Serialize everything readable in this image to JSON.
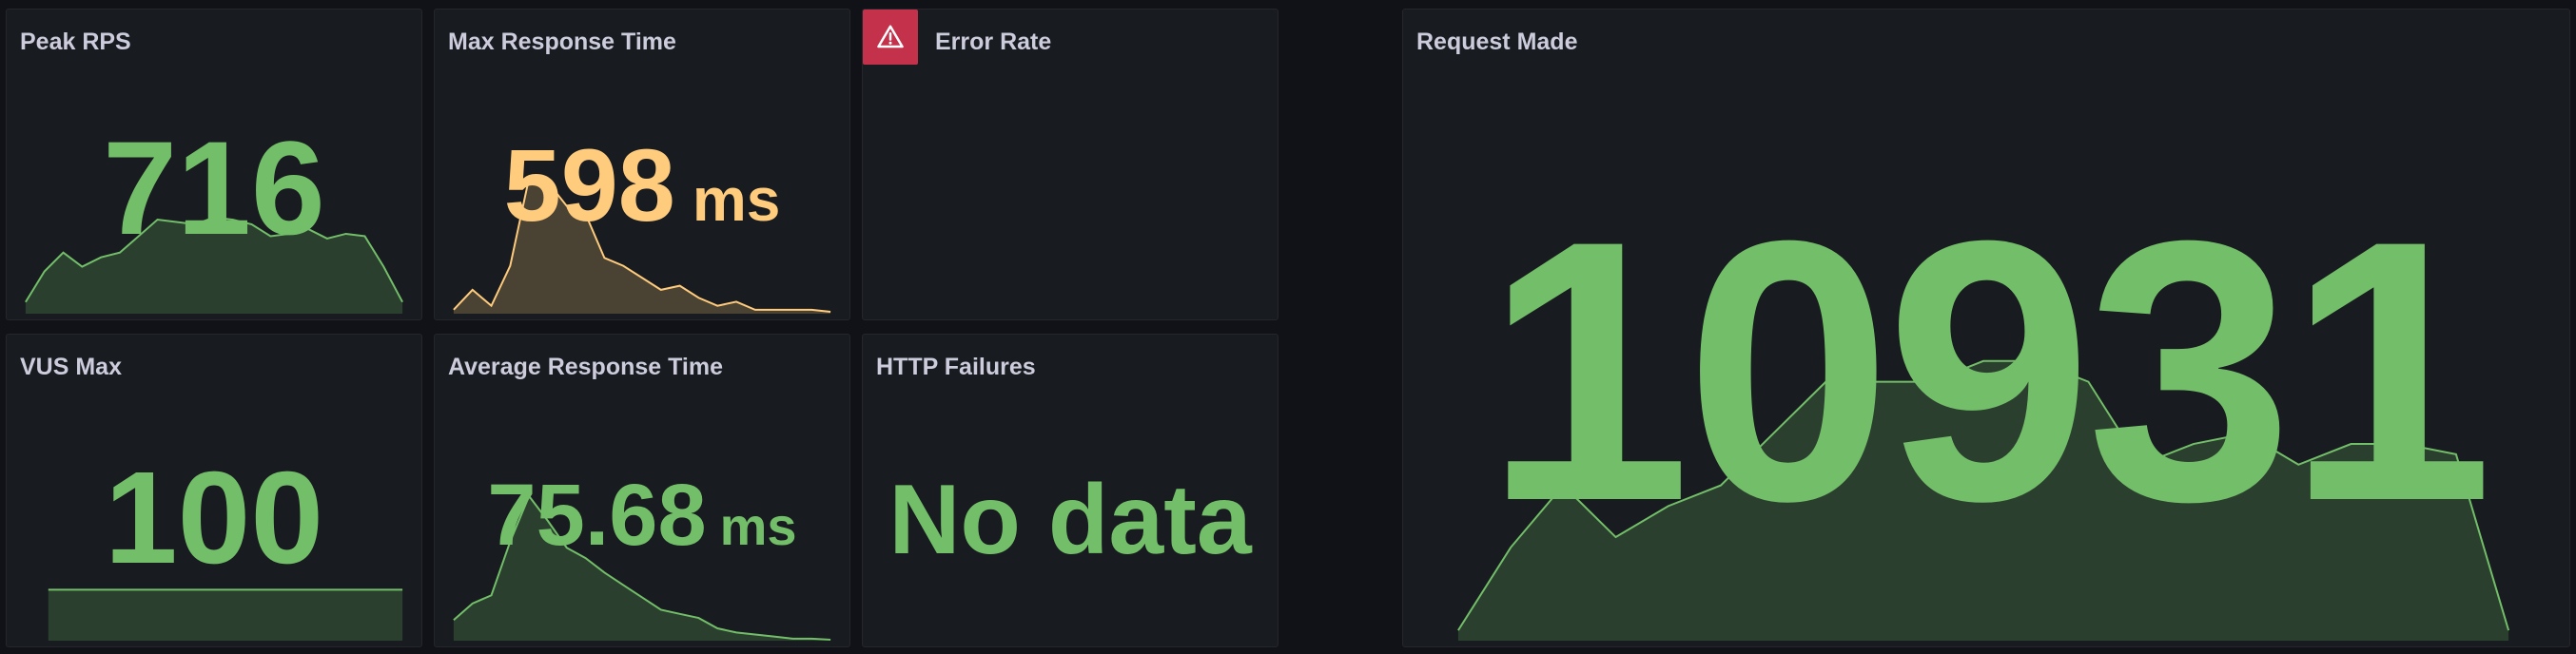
{
  "colors": {
    "green": "#73bf69",
    "orange": "#ffcb7d",
    "error": "#c4314b"
  },
  "panels": {
    "peak_rps": {
      "title": "Peak RPS",
      "value": "716",
      "color": "#73bf69",
      "sparkline": [
        5,
        18,
        26,
        20,
        24,
        26,
        33,
        40,
        39,
        38,
        41,
        40,
        38,
        33,
        34,
        36,
        32,
        34,
        33,
        20,
        5
      ]
    },
    "max_response": {
      "title": "Max Response Time",
      "value": "598",
      "unit": "ms",
      "color": "#ffcb7d",
      "sparkline": [
        1,
        6,
        2,
        12,
        34,
        33,
        27,
        25,
        14,
        12,
        9,
        6,
        7,
        4,
        2,
        3,
        1,
        1,
        1,
        1,
        0.5
      ]
    },
    "error_rate": {
      "title": "Error Rate",
      "icon": "warning-icon"
    },
    "request_made": {
      "title": "Request Made",
      "value": "10931",
      "color": "#73bf69",
      "sparkline": [
        1,
        9,
        15,
        10,
        13,
        15,
        20,
        25,
        25,
        25,
        27,
        27,
        25,
        17,
        19,
        20,
        17,
        19,
        19,
        18,
        1
      ]
    },
    "vus_max": {
      "title": "VUS Max",
      "value": "100",
      "color": "#73bf69",
      "sparkline": [
        100,
        100,
        100,
        100,
        100,
        100,
        100,
        100,
        100,
        100,
        100,
        100,
        100,
        100,
        100,
        100,
        100,
        100,
        100,
        100,
        100
      ]
    },
    "avg_response": {
      "title": "Average Response Time",
      "value": "75.68",
      "unit": "ms",
      "color": "#73bf69",
      "sparkline": [
        10,
        18,
        22,
        48,
        70,
        58,
        45,
        40,
        33,
        27,
        21,
        15,
        13,
        11,
        6,
        4,
        3,
        2,
        1,
        1,
        0.5
      ]
    },
    "http_failures": {
      "title": "HTTP Failures",
      "value": "No data",
      "color": "#73bf69"
    }
  }
}
